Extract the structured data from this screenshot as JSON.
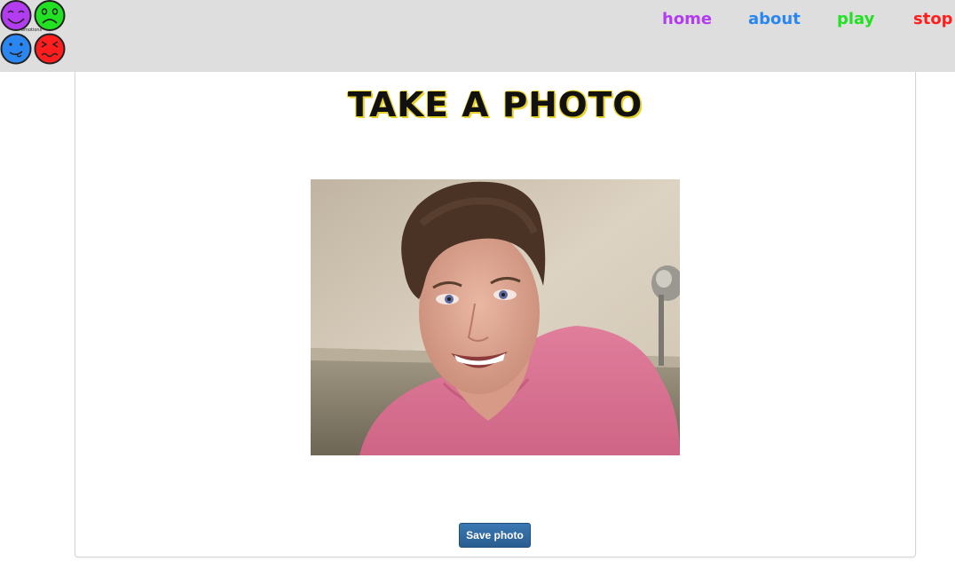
{
  "nav": {
    "logo_text": "emotions",
    "links": [
      {
        "label": "home",
        "color": "#b23cf0"
      },
      {
        "label": "about",
        "color": "#2a86f0"
      },
      {
        "label": "play",
        "color": "#22e022"
      },
      {
        "label": "stop",
        "color": "#ff1e1e"
      }
    ]
  },
  "main": {
    "title": "TAKE A PHOTO",
    "save_button": "Save photo"
  },
  "colors": {
    "navbar_bg": "#dedede",
    "face_purple": "#b23cf0",
    "face_green": "#22e022",
    "face_blue": "#2a86f0",
    "face_red": "#ff1e1e",
    "button": "#2f6aa3"
  },
  "icons": [
    "happy-face-icon",
    "worried-face-icon",
    "silly-face-icon",
    "angry-face-icon",
    "webcam-photo"
  ]
}
